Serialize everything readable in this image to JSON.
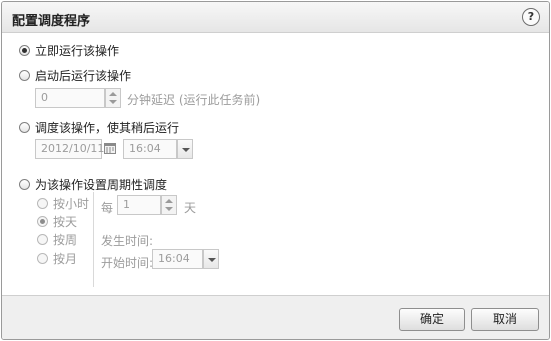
{
  "dialog": {
    "title": "配置调度程序",
    "help_icon": "?"
  },
  "options": {
    "run_now": {
      "label": "立即运行该操作",
      "selected": true
    },
    "run_after_start": {
      "label": "启动后运行该操作",
      "delay_value": "0",
      "delay_suffix": "分钟延迟 (运行此任务前)"
    },
    "schedule_later": {
      "label": "调度该操作，使其稍后运行",
      "date": "2012/10/11",
      "time": "16:04"
    },
    "recurring": {
      "label": "为该操作设置周期性调度",
      "frequency_options": [
        {
          "label": "按小时",
          "selected": false
        },
        {
          "label": "按天",
          "selected": true
        },
        {
          "label": "按周",
          "selected": false
        },
        {
          "label": "按月",
          "selected": false
        }
      ],
      "every_prefix": "每",
      "every_value": "1",
      "every_unit": "天",
      "occurs_at_label": "发生时间:",
      "start_time_label": "开始时间:",
      "start_time": "16:04"
    }
  },
  "footer": {
    "ok_label": "确定",
    "cancel_label": "取消"
  },
  "colors": {
    "disabled_text": "#9c9c9c",
    "title_bar": "#e6e6e6",
    "footer": "#efefef"
  }
}
